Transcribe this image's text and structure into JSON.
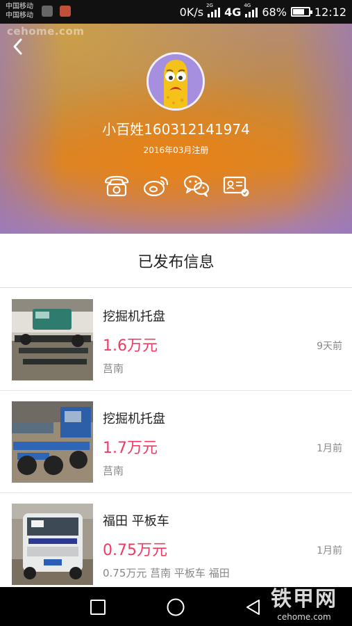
{
  "status_bar": {
    "carrier_1": "中国移动",
    "carrier_2": "中国移动",
    "net_speed": "0K/s",
    "net_1": "2G",
    "net_2": "4G",
    "net_3": "4G",
    "battery": "68%",
    "time": "12:12",
    "battery_level": 0.68
  },
  "watermark_top": "cehome.com",
  "profile": {
    "username": "小百姓160312141974",
    "register_date": "2016年03月注册",
    "contact_icons": [
      "phone-icon",
      "weibo-icon",
      "wechat-icon",
      "id-card-verified-icon"
    ]
  },
  "section_title": "已发布信息",
  "listings": [
    {
      "title": "挖掘机托盘",
      "price": "1.6万元",
      "location": "莒南",
      "time": "9天前",
      "thumb": "truck-chassis-photo"
    },
    {
      "title": "挖掘机托盘",
      "price": "1.7万元",
      "location": "莒南",
      "time": "1月前",
      "thumb": "blue-truck-chassis-photo"
    },
    {
      "title": "福田 平板车",
      "price": "0.75万元",
      "location": "0.75万元 莒南 平板车 福田",
      "time": "1月前",
      "thumb": "foton-flatbed-truck-photo"
    }
  ],
  "navbar": {
    "icons": [
      "recent-apps-icon",
      "home-icon",
      "back-icon"
    ]
  },
  "watermark_bottom": {
    "big": "铁甲网",
    "small": "cehome.com"
  },
  "colors": {
    "price": "#f03a64",
    "accent_orange": "#d98528",
    "avatar_bg": "#a78fe0"
  }
}
